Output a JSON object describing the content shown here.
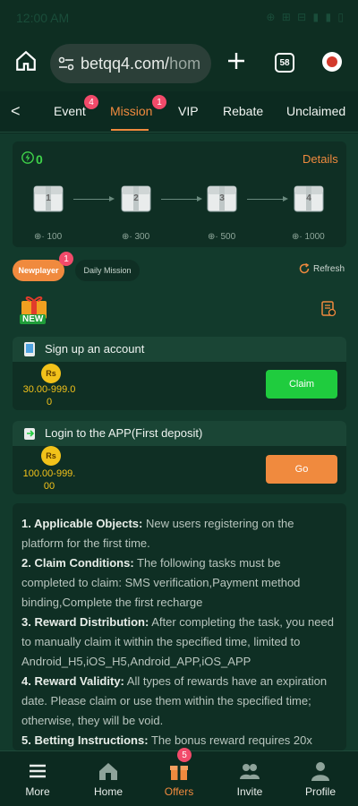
{
  "status": {
    "time": "12:00 AM",
    "icons": "⊕ ⊞ ⊟ ▮ ▮ ▯"
  },
  "browser": {
    "url": "betqq4.com/",
    "url_dim": "hom",
    "tab_count": "58"
  },
  "nav": {
    "tabs": [
      {
        "label": "Event",
        "badge": "4"
      },
      {
        "label": "Mission",
        "badge": "1"
      },
      {
        "label": "VIP",
        "badge": ""
      },
      {
        "label": "Rebate",
        "badge": ""
      },
      {
        "label": "Unclaimed",
        "badge": ""
      }
    ],
    "active": "Mission"
  },
  "progress": {
    "count": "0",
    "details_label": "Details",
    "chests": [
      {
        "num": "1",
        "label": "· 100"
      },
      {
        "num": "2",
        "label": "· 300"
      },
      {
        "num": "3",
        "label": "· 500"
      },
      {
        "num": "4",
        "label": "· 1000"
      }
    ]
  },
  "filters": {
    "newplayer": "Newplayer",
    "newplayer_badge": "1",
    "daily": "Daily Mission",
    "refresh": "Refresh"
  },
  "newbadge": "NEW",
  "tasks": [
    {
      "title": "Sign up an account",
      "currency": "Rs",
      "amount_1": "30.00-999.0",
      "amount_2": "0",
      "button": "Claim"
    },
    {
      "title": "Login to the APP(First deposit)",
      "currency": "Rs",
      "amount_1": "100.00-999.",
      "amount_2": "00",
      "button": "Go"
    }
  ],
  "rules": [
    {
      "head": "1. Applicable Objects:",
      "text": " New users registering on the platform for the first time."
    },
    {
      "head": "2. Claim Conditions:",
      "text": " The following tasks must be completed to claim: SMS verification,Payment method binding,Complete the first recharge"
    },
    {
      "head": "3. Reward Distribution:",
      "text": " After completing the task, you need to manually claim it within the specified time, limited to Android_H5,iOS_H5,Android_APP,iOS_APP"
    },
    {
      "head": "4. Reward Validity:",
      "text": " All types of rewards have an expiration date. Please claim or use them within the specified time; otherwise, they will be void."
    },
    {
      "head": "5. Betting Instructions:",
      "text": " The bonus reward requires 20x"
    }
  ],
  "bottomnav": [
    {
      "label": "More",
      "icon": "menu-icon"
    },
    {
      "label": "Home",
      "icon": "home-icon"
    },
    {
      "label": "Offers",
      "icon": "gift-icon",
      "badge": "5"
    },
    {
      "label": "Invite",
      "icon": "users-icon"
    },
    {
      "label": "Profile",
      "icon": "profile-icon"
    }
  ],
  "colors": {
    "accent": "#f08a3e",
    "claim": "#1fcc3e",
    "badge": "#f24a6a",
    "gold": "#f2c21a"
  }
}
